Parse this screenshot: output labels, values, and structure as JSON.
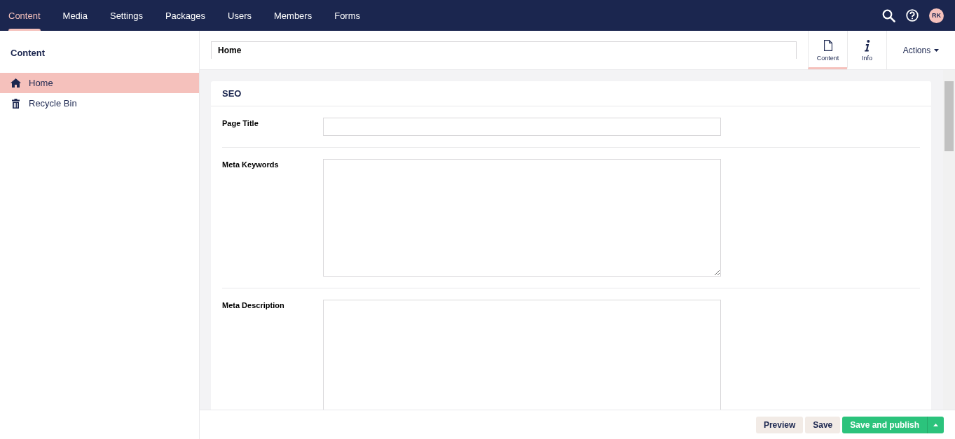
{
  "top_nav": {
    "sections": [
      {
        "label": "Content",
        "selected": true
      },
      {
        "label": "Media",
        "selected": false
      },
      {
        "label": "Settings",
        "selected": false
      },
      {
        "label": "Packages",
        "selected": false
      },
      {
        "label": "Users",
        "selected": false
      },
      {
        "label": "Members",
        "selected": false
      },
      {
        "label": "Forms",
        "selected": false
      }
    ],
    "avatar_initials": "RK"
  },
  "sidebar": {
    "title": "Content",
    "items": [
      {
        "label": "Home",
        "selected": true
      },
      {
        "label": "Recycle Bin",
        "selected": false
      }
    ]
  },
  "editor": {
    "name": "Home",
    "apps": [
      {
        "label": "Content",
        "selected": true
      },
      {
        "label": "Info",
        "selected": false
      }
    ],
    "actions": "Actions",
    "group": {
      "title": "SEO",
      "properties": [
        {
          "label": "Page Title",
          "kind": "text"
        },
        {
          "label": "Meta Keywords",
          "kind": "textarea"
        },
        {
          "label": "Meta Description",
          "kind": "textarea"
        }
      ]
    }
  },
  "footer": {
    "buttons": [
      {
        "label": "Preview",
        "kind": "plain"
      },
      {
        "label": "Save",
        "kind": "plain"
      },
      {
        "label": "Save and publish",
        "kind": "primary"
      }
    ]
  }
}
